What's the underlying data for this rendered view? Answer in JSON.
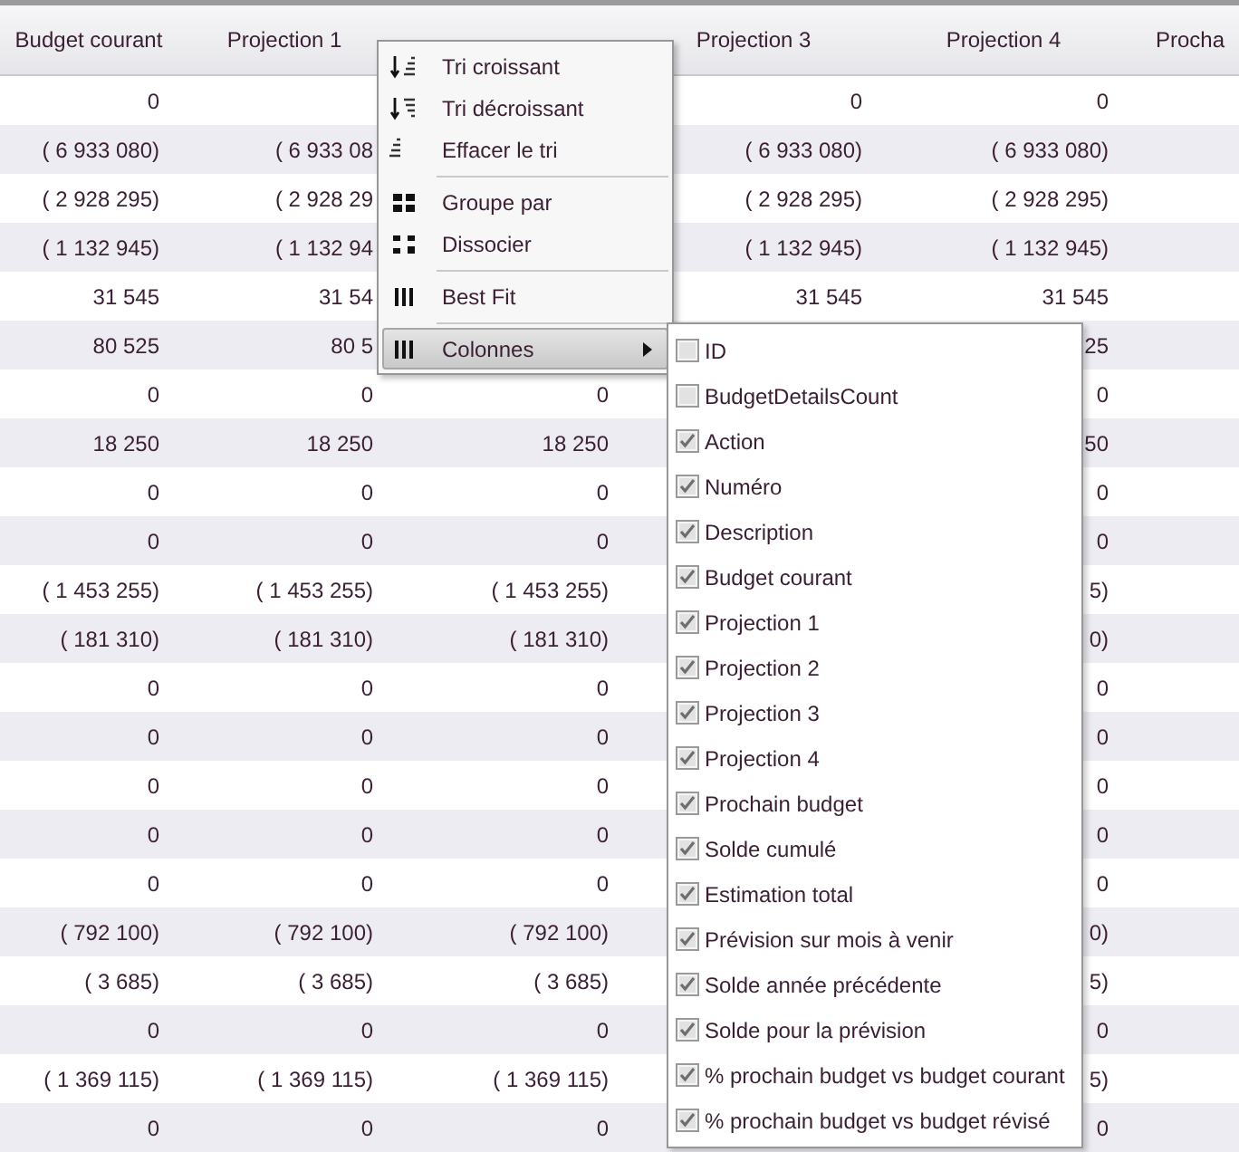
{
  "table": {
    "columns": [
      "Budget courant",
      "Projection 1",
      null,
      "Projection 3",
      "Projection 4",
      "Procha"
    ],
    "rows": [
      [
        "0",
        null,
        null,
        "0",
        "0"
      ],
      [
        "( 6 933 080)",
        "( 6 933 08",
        null,
        "( 6 933 080)",
        "( 6 933 080)"
      ],
      [
        "( 2 928 295)",
        "( 2 928 29",
        null,
        "( 2 928 295)",
        "( 2 928 295)"
      ],
      [
        "( 1 132 945)",
        "( 1 132 94",
        null,
        "( 1 132 945)",
        "( 1 132 945)"
      ],
      [
        "31 545",
        "31 54",
        null,
        "31 545",
        "31 545"
      ],
      [
        "80 525",
        "80 5",
        null,
        null,
        "25"
      ],
      [
        "0",
        "0",
        "0",
        null,
        "0"
      ],
      [
        "18 250",
        "18 250",
        "18 250",
        null,
        "50"
      ],
      [
        "0",
        "0",
        "0",
        null,
        "0"
      ],
      [
        "0",
        "0",
        "0",
        null,
        "0"
      ],
      [
        "( 1 453 255)",
        "( 1 453 255)",
        "( 1 453 255)",
        null,
        "5)"
      ],
      [
        "( 181 310)",
        "( 181 310)",
        "( 181 310)",
        null,
        "0)"
      ],
      [
        "0",
        "0",
        "0",
        null,
        "0"
      ],
      [
        "0",
        "0",
        "0",
        null,
        "0"
      ],
      [
        "0",
        "0",
        "0",
        null,
        "0"
      ],
      [
        "0",
        "0",
        "0",
        null,
        "0"
      ],
      [
        "0",
        "0",
        "0",
        null,
        "0"
      ],
      [
        "( 792 100)",
        "( 792 100)",
        "( 792 100)",
        null,
        "0)"
      ],
      [
        "( 3 685)",
        "( 3 685)",
        "( 3 685)",
        null,
        "5)"
      ],
      [
        "0",
        "0",
        "0",
        null,
        "0"
      ],
      [
        "( 1 369 115)",
        "( 1 369 115)",
        "( 1 369 115)",
        null,
        "5)"
      ],
      [
        "0",
        "0",
        "0",
        null,
        "0"
      ]
    ]
  },
  "menu": {
    "items": [
      {
        "kind": "item",
        "label": "Tri croissant",
        "selected": false,
        "submenu": false
      },
      {
        "kind": "item",
        "label": "Tri décroissant",
        "selected": false,
        "submenu": false
      },
      {
        "kind": "item",
        "label": "Effacer le tri",
        "selected": false,
        "submenu": false
      },
      {
        "kind": "separator"
      },
      {
        "kind": "item",
        "label": "Groupe par",
        "selected": false,
        "submenu": false
      },
      {
        "kind": "item",
        "label": "Dissocier",
        "selected": false,
        "submenu": false
      },
      {
        "kind": "separator"
      },
      {
        "kind": "item",
        "label": "Best Fit",
        "selected": false,
        "submenu": false
      },
      {
        "kind": "separator"
      },
      {
        "kind": "item",
        "label": "Colonnes",
        "selected": true,
        "submenu": true
      }
    ]
  },
  "column_chooser": [
    {
      "label": "ID",
      "checked": false
    },
    {
      "label": "BudgetDetailsCount",
      "checked": false
    },
    {
      "label": "Action",
      "checked": true
    },
    {
      "label": "Numéro",
      "checked": true
    },
    {
      "label": "Description",
      "checked": true
    },
    {
      "label": "Budget courant",
      "checked": true
    },
    {
      "label": "Projection 1",
      "checked": true
    },
    {
      "label": "Projection 2",
      "checked": true
    },
    {
      "label": "Projection 3",
      "checked": true
    },
    {
      "label": "Projection 4",
      "checked": true
    },
    {
      "label": "Prochain budget",
      "checked": true
    },
    {
      "label": "Solde cumulé",
      "checked": true
    },
    {
      "label": "Estimation total",
      "checked": true
    },
    {
      "label": "Prévision sur mois à venir",
      "checked": true
    },
    {
      "label": "Solde année précédente",
      "checked": true
    },
    {
      "label": "Solde pour la prévision",
      "checked": true
    },
    {
      "label": "% prochain budget vs budget courant",
      "checked": true
    },
    {
      "label": "% prochain budget vs budget révisé",
      "checked": true
    }
  ]
}
